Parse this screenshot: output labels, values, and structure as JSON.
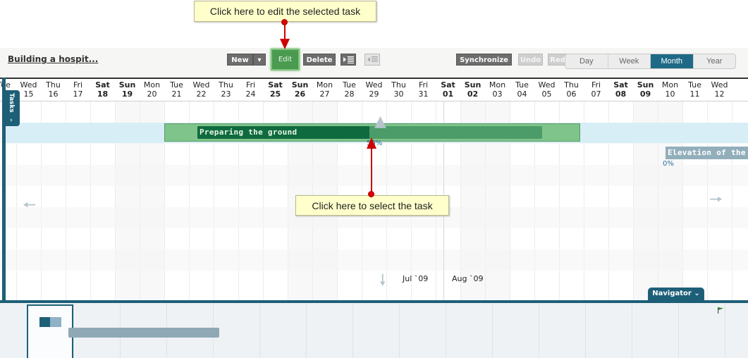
{
  "callouts": {
    "top": "Click here to edit the selected task",
    "middle": "Click here to select the task"
  },
  "toolbar": {
    "project_title": "Building a hospit...",
    "new_label": "New",
    "edit_label": "Edit",
    "delete_label": "Delete",
    "synchronize_label": "Synchronize",
    "undo_label": "Undo",
    "redo_label": "Red",
    "view_tabs": [
      {
        "label": "Day",
        "active": false
      },
      {
        "label": "Week",
        "active": false
      },
      {
        "label": "Month",
        "active": true
      },
      {
        "label": "Year",
        "active": false
      }
    ]
  },
  "gantt": {
    "tasks_tab_label": "Tasks",
    "days": [
      {
        "dow": "Tue",
        "date": "",
        "bold": false
      },
      {
        "dow": "Wed",
        "date": "15",
        "bold": false
      },
      {
        "dow": "Thu",
        "date": "16",
        "bold": false
      },
      {
        "dow": "Fri",
        "date": "17",
        "bold": false
      },
      {
        "dow": "Sat",
        "date": "18",
        "bold": true
      },
      {
        "dow": "Sun",
        "date": "19",
        "bold": true
      },
      {
        "dow": "Mon",
        "date": "20",
        "bold": false
      },
      {
        "dow": "Tue",
        "date": "21",
        "bold": false
      },
      {
        "dow": "Wed",
        "date": "22",
        "bold": false
      },
      {
        "dow": "Thu",
        "date": "23",
        "bold": false
      },
      {
        "dow": "Fri",
        "date": "24",
        "bold": false
      },
      {
        "dow": "Sat",
        "date": "25",
        "bold": true
      },
      {
        "dow": "Sun",
        "date": "26",
        "bold": true
      },
      {
        "dow": "Mon",
        "date": "27",
        "bold": false
      },
      {
        "dow": "Tue",
        "date": "28",
        "bold": false
      },
      {
        "dow": "Wed",
        "date": "29",
        "bold": false
      },
      {
        "dow": "Thu",
        "date": "30",
        "bold": false
      },
      {
        "dow": "Fri",
        "date": "31",
        "bold": false
      },
      {
        "dow": "Sat",
        "date": "01",
        "bold": true
      },
      {
        "dow": "Sun",
        "date": "02",
        "bold": true
      },
      {
        "dow": "Mon",
        "date": "03",
        "bold": false
      },
      {
        "dow": "Tue",
        "date": "04",
        "bold": false
      },
      {
        "dow": "Wed",
        "date": "05",
        "bold": false
      },
      {
        "dow": "Thu",
        "date": "06",
        "bold": false
      },
      {
        "dow": "Fri",
        "date": "07",
        "bold": false
      },
      {
        "dow": "Sat",
        "date": "08",
        "bold": true
      },
      {
        "dow": "Sun",
        "date": "09",
        "bold": true
      },
      {
        "dow": "Mon",
        "date": "10",
        "bold": false
      },
      {
        "dow": "Tue",
        "date": "11",
        "bold": false
      },
      {
        "dow": "Wed",
        "date": "12",
        "bold": false
      }
    ],
    "tasks": [
      {
        "name": "Preparing the ground",
        "percent": "50%",
        "progress": 0.5
      },
      {
        "name": "Elevation of the",
        "percent": "0%",
        "progress": 0
      }
    ],
    "month_labels": [
      "Jul `09",
      "Aug `09"
    ],
    "navigator_label": "Navigator"
  },
  "colors": {
    "accent": "#1e6a86",
    "task_green": "#7fc48a",
    "task_green_dark": "#0f6a3f",
    "callout_bg": "#ffffcc",
    "arrow_red": "#cc0000"
  }
}
